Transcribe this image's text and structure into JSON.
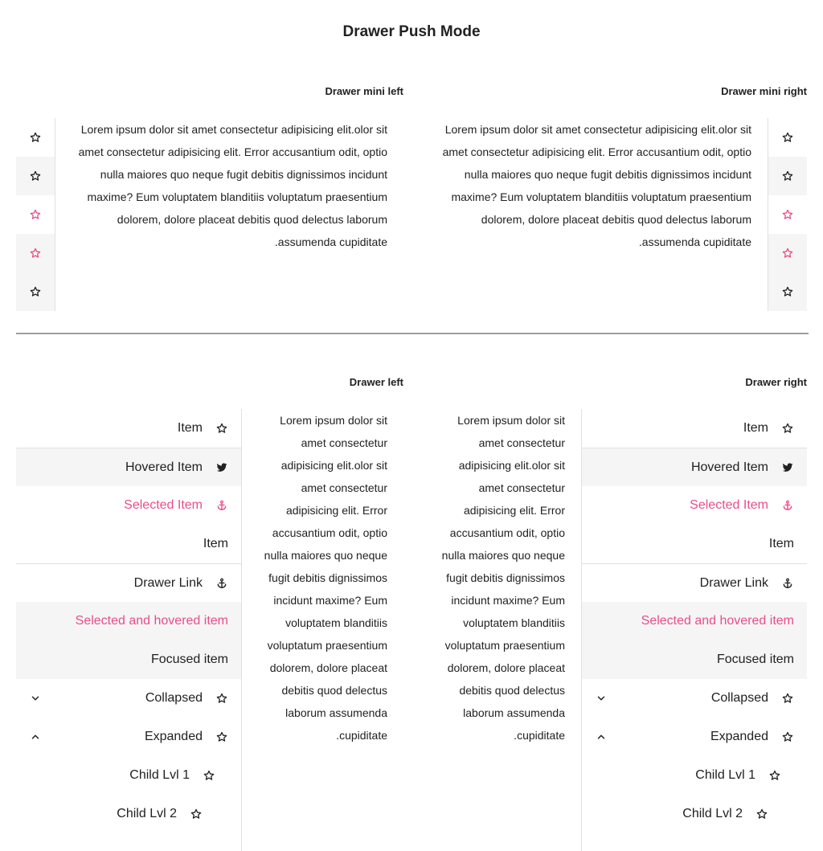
{
  "page_title": "Drawer Push Mode",
  "mini_left": {
    "title": "Drawer mini left"
  },
  "mini_right": {
    "title": "Drawer mini right"
  },
  "lorem": "Lorem ipsum dolor sit amet consectetur adipisicing elit.olor sit amet consectetur adipisicing elit. Error accusantium odit, optio nulla maiores quo neque fugit debitis dignissimos incidunt maxime? Eum voluptatem blanditiis voluptatum praesentium dolorem, dolore placeat debitis quod delectus laborum assumenda cupiditate.",
  "drawer_left": {
    "title": "Drawer left"
  },
  "drawer_right": {
    "title": "Drawer right"
  },
  "items": {
    "item": "Item",
    "hovered": "Hovered Item",
    "selected": "Selected Item",
    "item2": "Item",
    "link": "Drawer Link",
    "selected_hovered": "Selected and hovered item",
    "focused": "Focused item",
    "collapsed": "Collapsed",
    "expanded": "Expanded",
    "child1": "Child Lvl 1",
    "child2": "Child Lvl 2"
  },
  "icons": [
    "star-icon",
    "twitter-icon",
    "anchor-icon",
    "chevron-down-icon",
    "chevron-up-icon"
  ],
  "colors": {
    "accent": "#e84e89",
    "hover_bg": "#f5f5f5",
    "text": "#212121"
  }
}
